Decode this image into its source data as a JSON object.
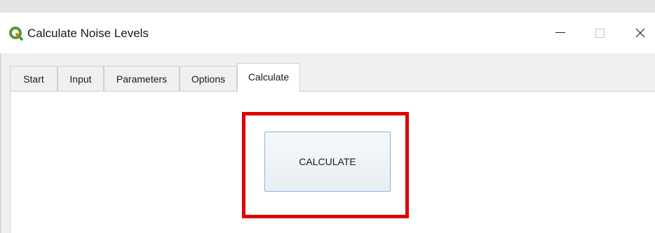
{
  "window": {
    "title": "Calculate Noise Levels",
    "app_icon": "qgis-logo-icon",
    "controls": {
      "minimize": "minimize-icon",
      "maximize": "maximize-icon",
      "close": "close-icon"
    }
  },
  "tabs": [
    {
      "label": "Start"
    },
    {
      "label": "Input"
    },
    {
      "label": "Parameters"
    },
    {
      "label": "Options"
    },
    {
      "label": "Calculate"
    }
  ],
  "active_tab": "Calculate",
  "panel": {
    "calculate_button_label": "CALCULATE"
  },
  "colors": {
    "highlight": "#e00000",
    "button_border": "#8ab4e0",
    "qgis_green": "#589632",
    "qgis_yellow": "#ee7913"
  }
}
